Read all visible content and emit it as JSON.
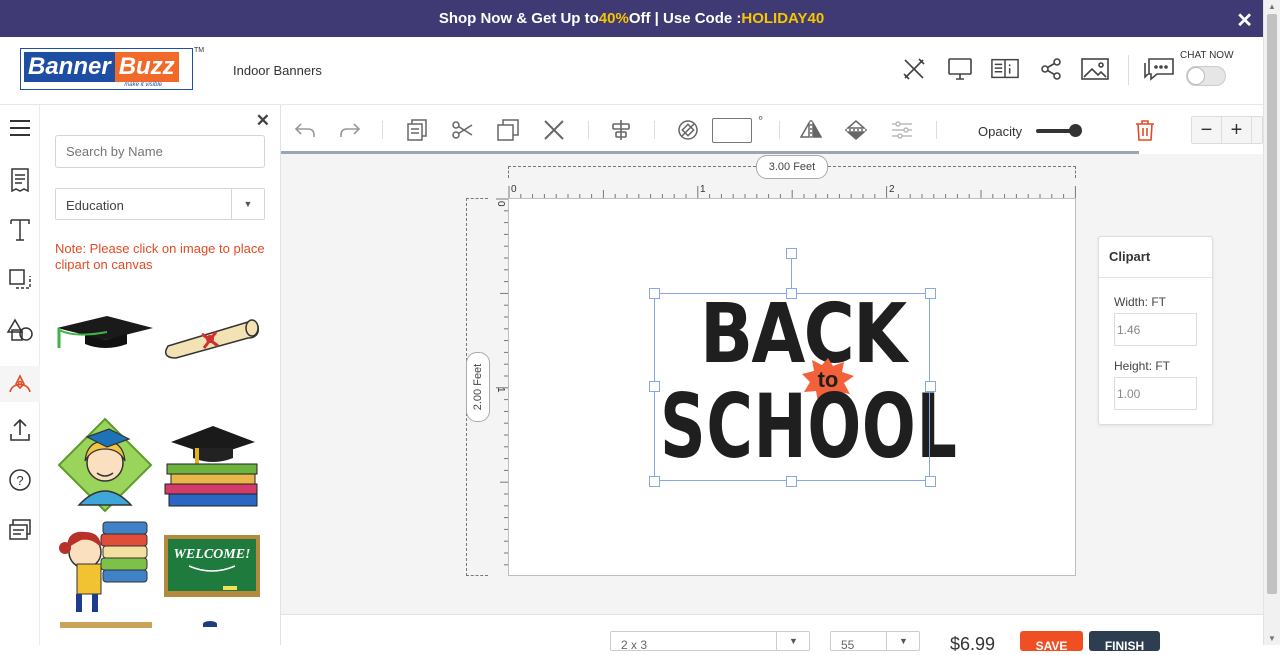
{
  "promo": {
    "prefix": "Shop Now & Get Up to ",
    "percent": "40%",
    "middle": " Off | Use Code : ",
    "code": "HOLIDAY40",
    "close": "✕"
  },
  "header": {
    "logo_part1": "Banner",
    "logo_part2": "Buzz",
    "logo_tagline": "make it visible",
    "trademark": "TM",
    "breadcrumb": "Indoor Banners",
    "icons": [
      "design-tools-icon",
      "desktop-preview-icon",
      "details-icon",
      "share-icon",
      "image-preview-icon",
      "chat-icon"
    ],
    "chat_label": "CHAT NOW"
  },
  "rail": {
    "items": [
      "menu-icon",
      "templates-icon",
      "text-icon",
      "background-icon",
      "shapes-icon",
      "clipart-icon",
      "upload-icon",
      "help-icon",
      "layers-icon"
    ]
  },
  "panel": {
    "close": "✕",
    "search_placeholder": "Search by Name",
    "category": "Education",
    "note": "Note: Please click on image to place clipart on canvas",
    "cliparts": [
      "graduation-cap",
      "diploma-scroll",
      "graduate-girl",
      "books-with-cap",
      "girl-with-books",
      "welcome-chalkboard"
    ]
  },
  "toolbar": {
    "rotation_value": "",
    "degree_symbol": "°",
    "opacity_label": "Opacity",
    "opacity_value": 1.0,
    "zoom_out": "−",
    "zoom_in": "+"
  },
  "canvas": {
    "width_label": "3.00 Feet",
    "height_label": "2.00 Feet",
    "ruler_h": [
      "0",
      "1",
      "2"
    ],
    "ruler_v": [
      "0",
      "1"
    ],
    "art_line1": "BACK",
    "art_to": "to",
    "art_line2": "SCHOOL"
  },
  "properties": {
    "title": "Clipart",
    "width_label": "Width: FT",
    "width_value": "1.46",
    "height_label": "Height: FT",
    "height_value": "1.00"
  },
  "footer": {
    "select1": "2 x 3",
    "select2": "55",
    "price": "$6.99",
    "save": "SAVE",
    "finish": "FINISH"
  },
  "colors": {
    "promo_bg": "#3f3a73",
    "promo_highlight": "#f7c600",
    "brand_blue": "#1d4ea3",
    "brand_orange": "#f26a2a",
    "note_red": "#e44a25",
    "selection": "#86a8e6"
  }
}
